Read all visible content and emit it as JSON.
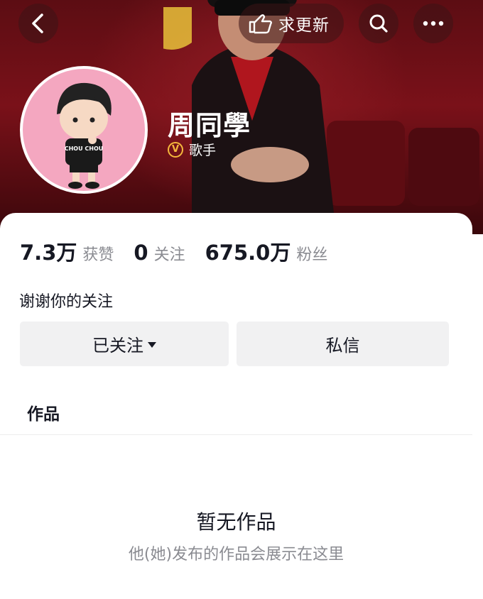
{
  "nav": {
    "request_update_label": "求更新"
  },
  "profile": {
    "name": "周同學",
    "verified_badge": "V",
    "role": "歌手",
    "avatar_text": "CHOU CHOU"
  },
  "stats": [
    {
      "value": "7.3万",
      "label": "获赞"
    },
    {
      "value": "0",
      "label": "关注"
    },
    {
      "value": "675.0万",
      "label": "粉丝"
    }
  ],
  "bio": "谢谢你的关注",
  "actions": {
    "follow_label": "已关注",
    "message_label": "私信"
  },
  "tabs": {
    "works_label": "作品"
  },
  "empty_state": {
    "title": "暂无作品",
    "description": "他(她)发布的作品会展示在这里"
  },
  "colors": {
    "banner": "#7a1119",
    "avatar_bg": "#f4a7c0",
    "badge": "#f5b83c",
    "muted_text": "#8a8b91",
    "button_bg": "#f1f1f2"
  }
}
